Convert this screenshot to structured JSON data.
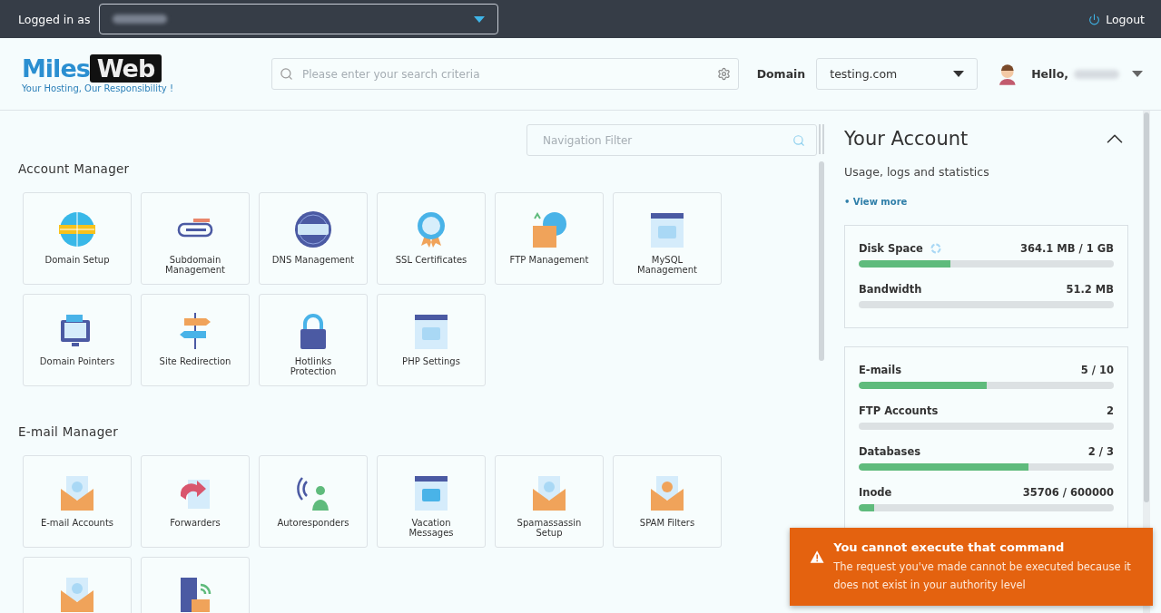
{
  "top_bar": {
    "logged_in_label": "Logged in as",
    "logout": "Logout"
  },
  "logo": {
    "first_word": "Miles",
    "second_word": "Web",
    "tagline": "Your Hosting, Our Responsibility !"
  },
  "search": {
    "placeholder": "Please enter your search criteria"
  },
  "domain": {
    "label": "Domain",
    "value": "testing.com"
  },
  "user": {
    "greeting": "Hello,"
  },
  "navigation_filter": {
    "placeholder": "Navigation Filter"
  },
  "sections": [
    {
      "title": "Account Manager",
      "items": [
        {
          "label": "Domain Setup",
          "kind": "globe"
        },
        {
          "label": "Subdomain Management",
          "kind": "link"
        },
        {
          "label": "DNS Management",
          "kind": "dns"
        },
        {
          "label": "SSL Certificates",
          "kind": "ssl"
        },
        {
          "label": "FTP Management",
          "kind": "ftp"
        },
        {
          "label": "MySQL Management",
          "kind": "sql"
        },
        {
          "label": "Domain Pointers",
          "kind": "monitor"
        },
        {
          "label": "Site Redirection",
          "kind": "signpost"
        },
        {
          "label": "Hotlinks Protection",
          "kind": "lock"
        },
        {
          "label": "PHP Settings",
          "kind": "php"
        }
      ]
    },
    {
      "title": "E-mail Manager",
      "items": [
        {
          "label": "E-mail Accounts",
          "kind": "mail"
        },
        {
          "label": "Forwarders",
          "kind": "forward"
        },
        {
          "label": "Autoresponders",
          "kind": "broadcast"
        },
        {
          "label": "Vacation Messages",
          "kind": "vacation"
        },
        {
          "label": "Spamassassin Setup",
          "kind": "spam"
        },
        {
          "label": "SPAM Filters",
          "kind": "smile"
        },
        {
          "kind": "mailnote"
        },
        {
          "kind": "server"
        }
      ]
    }
  ],
  "account": {
    "title": "Your Account",
    "subtitle": "Usage, logs and statistics",
    "view_more": "• View more",
    "groups": [
      [
        {
          "name": "Disk Space",
          "reading": "364.1 MB / 1 GB",
          "level": 0.36,
          "loading": true
        },
        {
          "name": "Bandwidth",
          "reading": "51.2 MB",
          "level": 0
        }
      ],
      [
        {
          "name": "E-mails",
          "reading": "5 / 10",
          "level": 0.5
        },
        {
          "name": "FTP Accounts",
          "reading": "2",
          "level": 0
        },
        {
          "name": "Databases",
          "reading": "2 / 3",
          "level": 0.667
        },
        {
          "name": "Inode",
          "reading": "35706 / 600000",
          "level": 0.06
        }
      ]
    ]
  },
  "toast": {
    "title": "You cannot execute that command",
    "message": "The request you've made cannot be executed because it does not exist in your authority level"
  }
}
